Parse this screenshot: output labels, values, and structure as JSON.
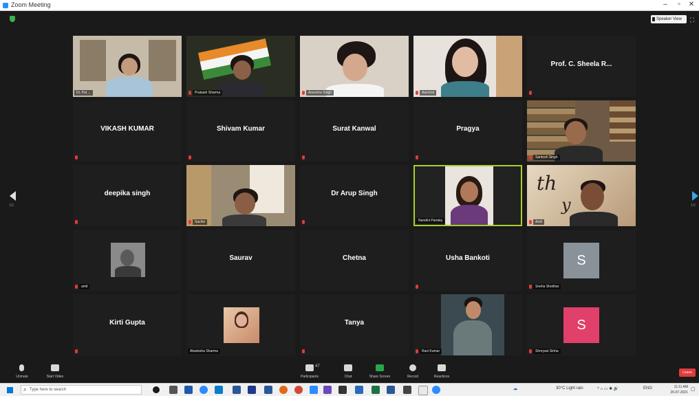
{
  "window": {
    "title": "Zoom Meeting",
    "controls": [
      "–",
      "▫",
      "✕"
    ]
  },
  "topbar": {
    "view_button": "Speaker View"
  },
  "navigation": {
    "left_page": "1/2",
    "right_page": "1/2"
  },
  "tiles": [
    {
      "id": "t1",
      "type": "video",
      "label": "Dr. Pal ...",
      "muted": false
    },
    {
      "id": "t2",
      "type": "video",
      "label": "Prakash Sharma",
      "muted": true
    },
    {
      "id": "t3",
      "type": "video",
      "label": "Aneesha Singh",
      "muted": true
    },
    {
      "id": "t4",
      "type": "video",
      "label": "Aanchal",
      "muted": true
    },
    {
      "id": "t5",
      "type": "name",
      "name": "Prof. C. Sheela R...",
      "muted": true
    },
    {
      "id": "t6",
      "type": "name",
      "name": "VIKASH KUMAR",
      "muted": true
    },
    {
      "id": "t7",
      "type": "name",
      "name": "Shivam Kumar",
      "muted": true
    },
    {
      "id": "t8",
      "type": "name",
      "name": "Surat Kanwal",
      "muted": true
    },
    {
      "id": "t9",
      "type": "name",
      "name": "Pragya",
      "muted": true
    },
    {
      "id": "t10",
      "type": "video",
      "label": "Santosh Singh",
      "muted": true
    },
    {
      "id": "t11",
      "type": "name",
      "name": "deepika singh",
      "muted": true
    },
    {
      "id": "t12",
      "type": "video",
      "label": "Sachin",
      "muted": true
    },
    {
      "id": "t13",
      "type": "name",
      "name": "Dr Arup Singh",
      "muted": true
    },
    {
      "id": "t14",
      "type": "video",
      "label": "Nandini Pandey",
      "muted": false,
      "active": true
    },
    {
      "id": "t15",
      "type": "video",
      "label": "Amit",
      "muted": true
    },
    {
      "id": "t16",
      "type": "photo",
      "label": "amit",
      "muted": true
    },
    {
      "id": "t17",
      "type": "name",
      "name": "Saurav",
      "muted": true
    },
    {
      "id": "t18",
      "type": "name",
      "name": "Chetna",
      "muted": true
    },
    {
      "id": "t19",
      "type": "name",
      "name": "Usha Bankoti",
      "muted": true
    },
    {
      "id": "t20",
      "type": "avatar",
      "letter": "S",
      "label": "Sneha Shekhar",
      "avatar_color": "#8a9299",
      "muted": true
    },
    {
      "id": "t21",
      "type": "name",
      "name": "Kirti Gupta",
      "muted": true
    },
    {
      "id": "t22",
      "type": "photo",
      "label": "Akanksha Sharma",
      "muted": false
    },
    {
      "id": "t23",
      "type": "name",
      "name": "Tanya",
      "muted": true
    },
    {
      "id": "t24",
      "type": "photo",
      "label": "Ravi Kumar",
      "muted": true
    },
    {
      "id": "t25",
      "type": "avatar",
      "letter": "S",
      "label": "Shreyasi Sinha",
      "avatar_color": "#e0406a",
      "muted": true
    }
  ],
  "toolbar": {
    "unmute": "Unmute",
    "video": "Start Video",
    "participants": "Participants",
    "participants_count": "47",
    "chat": "Chat",
    "share": "Share Screen",
    "record": "Record",
    "reactions": "Reactions",
    "leave": "Leave"
  },
  "taskbar": {
    "search_placeholder": "Type here to search",
    "weather": "30°C Light rain",
    "lang": "ENG",
    "time": "11:11 AM",
    "date": "26-07-2021"
  },
  "colors": {
    "background": "#1a1a1a",
    "tile": "#1e1e1e",
    "active_border": "#a7d12c",
    "leave": "#e23b3b",
    "share": "#2aa64a"
  }
}
